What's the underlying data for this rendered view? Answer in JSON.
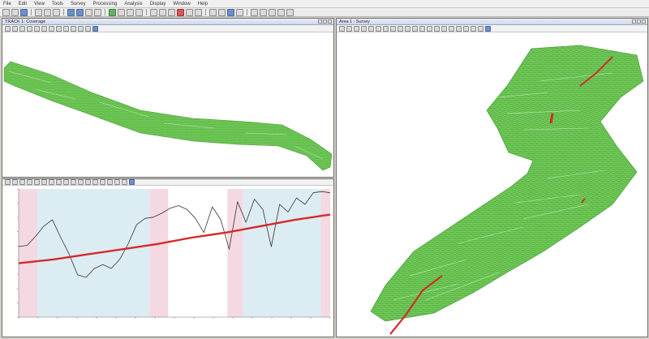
{
  "menu": {
    "items": [
      "File",
      "Edit",
      "View",
      "Tools",
      "Survey",
      "Processing",
      "Analysis",
      "Display",
      "Window",
      "Help"
    ]
  },
  "windows": {
    "map_top": {
      "title": "TRACK 1: Coverage"
    },
    "profile": {
      "title": ""
    },
    "map_right": {
      "title": "Area 1 : Survey"
    }
  },
  "chart_data": {
    "type": "line",
    "title": "",
    "xlabel": "",
    "ylabel": "",
    "series": [
      {
        "values": [
          0.55,
          0.56,
          0.63,
          0.71,
          0.76,
          0.62,
          0.49,
          0.33,
          0.31,
          0.38,
          0.41,
          0.38,
          0.45,
          0.57,
          0.72,
          0.77,
          0.78,
          0.81,
          0.85,
          0.87,
          0.84,
          0.77,
          0.66,
          0.86,
          0.76,
          0.53,
          0.9,
          0.74,
          0.92,
          0.84,
          0.55,
          0.88,
          0.82,
          0.93,
          0.88,
          0.97,
          0.98,
          0.97
        ]
      },
      {
        "values": [
          0.42,
          0.45,
          0.49,
          0.53,
          0.57,
          0.62,
          0.66,
          0.71,
          0.76,
          0.8
        ]
      }
    ],
    "shaded_bands": {
      "pink": [
        [
          0.0,
          0.06
        ],
        [
          0.42,
          0.48
        ],
        [
          0.67,
          0.72
        ],
        [
          0.97,
          1.0
        ]
      ],
      "blue": [
        [
          0.06,
          0.42
        ],
        [
          0.72,
          0.97
        ]
      ]
    },
    "colors": {
      "trace": "#333333",
      "trend": "#d42a2a",
      "pink": "#f4d9e2",
      "blue": "#dcecf3"
    }
  },
  "colors": {
    "coverage": "#5dbb46",
    "coverage_dark": "#4a9d38",
    "track": "#d42a2a"
  }
}
